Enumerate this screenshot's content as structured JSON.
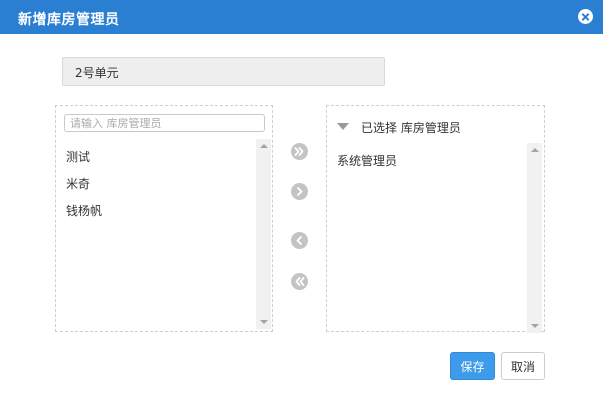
{
  "dialog": {
    "title": "新增库房管理员",
    "close_icon": "close-icon"
  },
  "unit": {
    "value": "2号单元"
  },
  "available": {
    "search_placeholder": "请输入 库房管理员",
    "items": [
      "测试",
      "米奇",
      "钱杨帆"
    ]
  },
  "selected": {
    "header": "已选择 库房管理员",
    "items": [
      "系统管理员"
    ]
  },
  "transfer": {
    "all_right_icon": "double-chevron-right-icon",
    "right_icon": "chevron-right-icon",
    "left_icon": "chevron-left-icon",
    "all_left_icon": "double-chevron-left-icon"
  },
  "actions": {
    "save_label": "保存",
    "cancel_label": "取消"
  },
  "colors": {
    "titlebar": "#2b7fd3",
    "primary_button": "#3d9be9",
    "transfer_button": "#c4c4c4"
  }
}
